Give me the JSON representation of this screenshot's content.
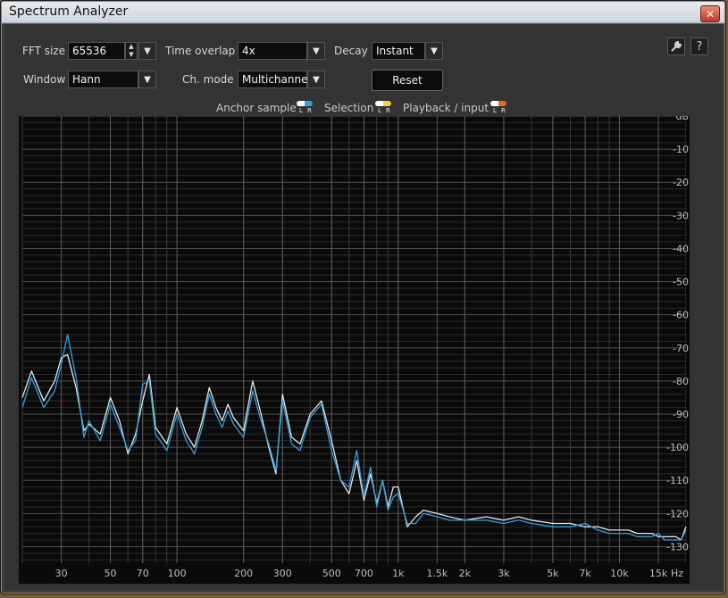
{
  "window": {
    "title": "Spectrum Analyzer",
    "close_glyph": "✕"
  },
  "controls": {
    "fft_size": {
      "label": "FFT size",
      "value": "65536"
    },
    "time_overlap": {
      "label": "Time overlap",
      "value": "4x"
    },
    "decay": {
      "label": "Decay",
      "value": "Instant"
    },
    "window": {
      "label": "Window",
      "value": "Hann"
    },
    "ch_mode": {
      "label": "Ch. mode",
      "value": "Multichannel"
    },
    "reset_label": "Reset",
    "settings_icon": "wrench-icon",
    "help_glyph": "?"
  },
  "legend": {
    "anchor": {
      "label": "Anchor sample",
      "l": "L",
      "r": "R",
      "color_l": "#ffffff",
      "color_r": "#2ea2e0"
    },
    "selection": {
      "label": "Selection",
      "l": "L",
      "r": "R",
      "color_l": "#ffffff",
      "color_r": "#f3d23b"
    },
    "playback": {
      "label": "Playback / input",
      "l": "L",
      "r": "R",
      "color_l": "#ffffff",
      "color_r": "#e8672a"
    }
  },
  "chart_data": {
    "type": "line",
    "x_scale": "log",
    "x_unit": "Hz",
    "y_unit": "dB",
    "xlim": [
      20,
      20000
    ],
    "ylim": [
      -135,
      0
    ],
    "x_ticks": [
      {
        "label": "30",
        "value": 30
      },
      {
        "label": "50",
        "value": 50
      },
      {
        "label": "70",
        "value": 70
      },
      {
        "label": "100",
        "value": 100
      },
      {
        "label": "200",
        "value": 200
      },
      {
        "label": "300",
        "value": 300
      },
      {
        "label": "500",
        "value": 500
      },
      {
        "label": "700",
        "value": 700
      },
      {
        "label": "1k",
        "value": 1000
      },
      {
        "label": "1.5k",
        "value": 1500
      },
      {
        "label": "2k",
        "value": 2000
      },
      {
        "label": "3k",
        "value": 3000
      },
      {
        "label": "5k",
        "value": 5000
      },
      {
        "label": "7k",
        "value": 7000
      },
      {
        "label": "10k",
        "value": 10000
      },
      {
        "label": "15k",
        "value": 15000
      }
    ],
    "x_unit_label": "Hz",
    "y_ticks": [
      {
        "label": "dB",
        "value": 0
      },
      {
        "label": "-10",
        "value": -10
      },
      {
        "label": "-20",
        "value": -20
      },
      {
        "label": "-30",
        "value": -30
      },
      {
        "label": "-40",
        "value": -40
      },
      {
        "label": "-50",
        "value": -50
      },
      {
        "label": "-60",
        "value": -60
      },
      {
        "label": "-70",
        "value": -70
      },
      {
        "label": "-80",
        "value": -80
      },
      {
        "label": "-90",
        "value": -90
      },
      {
        "label": "-100",
        "value": -100
      },
      {
        "label": "-110",
        "value": -110
      },
      {
        "label": "-120",
        "value": -120
      },
      {
        "label": "-130",
        "value": -130
      }
    ],
    "grid": true,
    "series": [
      {
        "channel": "L",
        "color": "#e6e6e6",
        "x": [
          20,
          22,
          25,
          28,
          30,
          32,
          35,
          38,
          40,
          45,
          50,
          55,
          60,
          65,
          70,
          75,
          80,
          90,
          100,
          110,
          120,
          130,
          140,
          150,
          160,
          170,
          180,
          200,
          220,
          240,
          260,
          280,
          300,
          330,
          360,
          400,
          450,
          500,
          550,
          600,
          650,
          700,
          750,
          800,
          850,
          900,
          950,
          1000,
          1100,
          1200,
          1300,
          1500,
          1700,
          2000,
          2500,
          3000,
          3500,
          4000,
          5000,
          6000,
          7000,
          8000,
          9000,
          10000,
          11000,
          12000,
          14000,
          15000,
          16000,
          18000,
          19000,
          20000
        ],
        "y": [
          -85,
          -77,
          -86,
          -80,
          -73,
          -72,
          -82,
          -95,
          -93,
          -96,
          -85,
          -92,
          -102,
          -96,
          -86,
          -78,
          -94,
          -99,
          -88,
          -96,
          -100,
          -92,
          -82,
          -88,
          -92,
          -87,
          -91,
          -95,
          -80,
          -90,
          -100,
          -108,
          -84,
          -97,
          -99,
          -90,
          -86,
          -98,
          -110,
          -114,
          -104,
          -116,
          -108,
          -117,
          -110,
          -118,
          -112,
          -112,
          -124,
          -121,
          -119,
          -120,
          -121,
          -122,
          -121,
          -122,
          -121,
          -122,
          -123,
          -123,
          -124,
          -124,
          -125,
          -125,
          -125,
          -126,
          -126,
          -127,
          -127,
          -127,
          -128,
          -124
        ]
      },
      {
        "channel": "R",
        "color": "#2ea2e0",
        "x": [
          20,
          22,
          25,
          28,
          30,
          32,
          35,
          38,
          40,
          45,
          50,
          55,
          60,
          65,
          70,
          75,
          80,
          90,
          100,
          110,
          120,
          130,
          140,
          150,
          160,
          170,
          180,
          200,
          220,
          240,
          260,
          280,
          300,
          330,
          360,
          400,
          450,
          500,
          550,
          600,
          650,
          700,
          750,
          800,
          850,
          900,
          950,
          1000,
          1100,
          1200,
          1300,
          1500,
          1700,
          2000,
          2500,
          3000,
          3500,
          4000,
          5000,
          6000,
          7000,
          8000,
          9000,
          10000,
          11000,
          12000,
          14000,
          15000,
          16000,
          18000,
          19000,
          20000
        ],
        "y": [
          -88,
          -79,
          -88,
          -83,
          -75,
          -66,
          -79,
          -97,
          -92,
          -98,
          -87,
          -94,
          -101,
          -98,
          -81,
          -80,
          -96,
          -101,
          -90,
          -98,
          -102,
          -94,
          -84,
          -90,
          -94,
          -89,
          -93,
          -97,
          -83,
          -92,
          -99,
          -107,
          -86,
          -99,
          -101,
          -91,
          -87,
          -101,
          -110,
          -112,
          -101,
          -115,
          -106,
          -118,
          -110,
          -119,
          -115,
          -114,
          -123,
          -123,
          -120,
          -121,
          -122,
          -122,
          -122,
          -123,
          -122,
          -123,
          -124,
          -124,
          -123,
          -125,
          -126,
          -126,
          -126,
          -127,
          -127,
          -126,
          -128,
          -128,
          -128,
          -125
        ]
      }
    ]
  }
}
